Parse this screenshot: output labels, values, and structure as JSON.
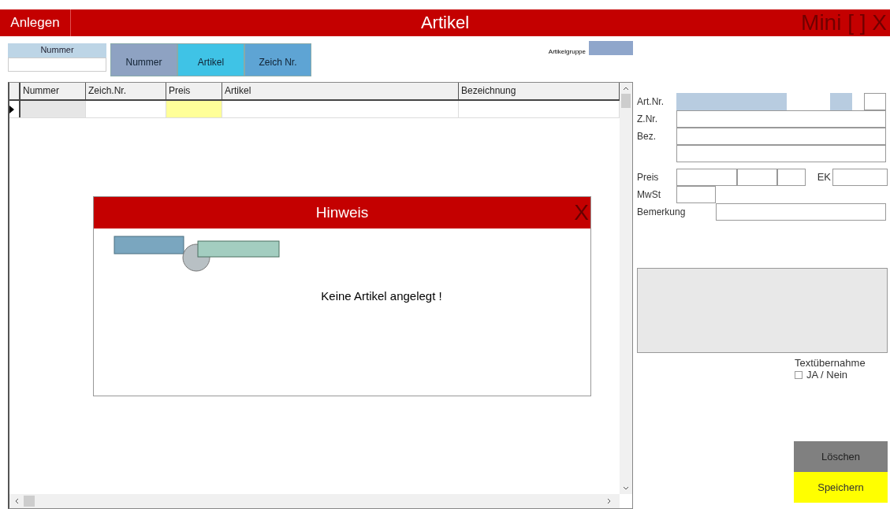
{
  "title_bar": {
    "button": "Anlegen",
    "title": "Artikel",
    "window_controls": "Mini [ ] X"
  },
  "search": {
    "label": "Nummer"
  },
  "sort_tabs": [
    {
      "label": "Nummer",
      "color": "#8ea2c2"
    },
    {
      "label": "Artikel",
      "color": "#3fc3e6"
    },
    {
      "label": "Zeich Nr.",
      "color": "#5ea4d4"
    }
  ],
  "group": {
    "label": "Artikelgruppe"
  },
  "table": {
    "columns": [
      "Nummer",
      "Zeich.Nr.",
      "Preis",
      "Artikel",
      "Bezeichnung"
    ]
  },
  "form": {
    "art_nr": "Art.Nr.",
    "z_nr": "Z.Nr.",
    "bez": "Bez.",
    "preis": "Preis",
    "ek": "EK",
    "mwst": "MwSt",
    "bemerkung": "Bemerkung"
  },
  "text_transfer": {
    "label": "Textübernahme",
    "option": "JA / Nein",
    "checked": false
  },
  "buttons": {
    "delete": "Löschen",
    "save": "Speichern"
  },
  "dialog": {
    "title": "Hinweis",
    "close": "X",
    "message": "Keine Artikel angelegt !"
  }
}
